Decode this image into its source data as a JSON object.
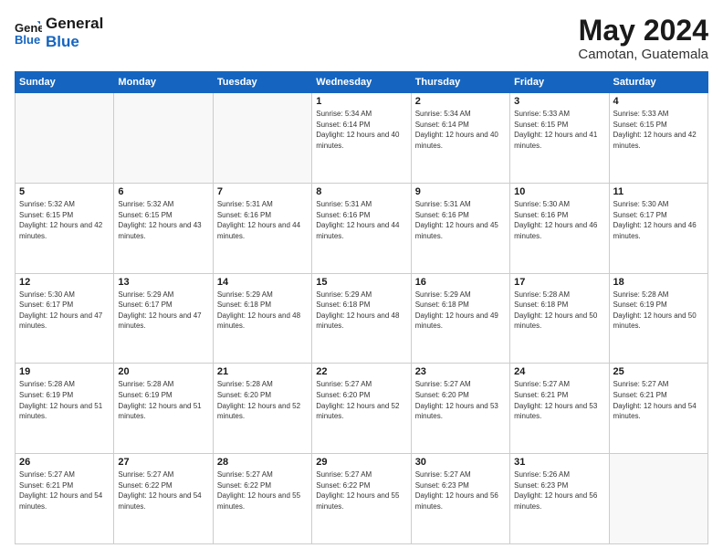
{
  "header": {
    "logo_general": "General",
    "logo_blue": "Blue",
    "main_title": "May 2024",
    "subtitle": "Camotan, Guatemala"
  },
  "days_of_week": [
    "Sunday",
    "Monday",
    "Tuesday",
    "Wednesday",
    "Thursday",
    "Friday",
    "Saturday"
  ],
  "weeks": [
    [
      {
        "day": "",
        "empty": true
      },
      {
        "day": "",
        "empty": true
      },
      {
        "day": "",
        "empty": true
      },
      {
        "day": "1",
        "sunrise": "5:34 AM",
        "sunset": "6:14 PM",
        "daylight": "12 hours and 40 minutes."
      },
      {
        "day": "2",
        "sunrise": "5:34 AM",
        "sunset": "6:14 PM",
        "daylight": "12 hours and 40 minutes."
      },
      {
        "day": "3",
        "sunrise": "5:33 AM",
        "sunset": "6:15 PM",
        "daylight": "12 hours and 41 minutes."
      },
      {
        "day": "4",
        "sunrise": "5:33 AM",
        "sunset": "6:15 PM",
        "daylight": "12 hours and 42 minutes."
      }
    ],
    [
      {
        "day": "5",
        "sunrise": "5:32 AM",
        "sunset": "6:15 PM",
        "daylight": "12 hours and 42 minutes."
      },
      {
        "day": "6",
        "sunrise": "5:32 AM",
        "sunset": "6:15 PM",
        "daylight": "12 hours and 43 minutes."
      },
      {
        "day": "7",
        "sunrise": "5:31 AM",
        "sunset": "6:16 PM",
        "daylight": "12 hours and 44 minutes."
      },
      {
        "day": "8",
        "sunrise": "5:31 AM",
        "sunset": "6:16 PM",
        "daylight": "12 hours and 44 minutes."
      },
      {
        "day": "9",
        "sunrise": "5:31 AM",
        "sunset": "6:16 PM",
        "daylight": "12 hours and 45 minutes."
      },
      {
        "day": "10",
        "sunrise": "5:30 AM",
        "sunset": "6:16 PM",
        "daylight": "12 hours and 46 minutes."
      },
      {
        "day": "11",
        "sunrise": "5:30 AM",
        "sunset": "6:17 PM",
        "daylight": "12 hours and 46 minutes."
      }
    ],
    [
      {
        "day": "12",
        "sunrise": "5:30 AM",
        "sunset": "6:17 PM",
        "daylight": "12 hours and 47 minutes."
      },
      {
        "day": "13",
        "sunrise": "5:29 AM",
        "sunset": "6:17 PM",
        "daylight": "12 hours and 47 minutes."
      },
      {
        "day": "14",
        "sunrise": "5:29 AM",
        "sunset": "6:18 PM",
        "daylight": "12 hours and 48 minutes."
      },
      {
        "day": "15",
        "sunrise": "5:29 AM",
        "sunset": "6:18 PM",
        "daylight": "12 hours and 48 minutes."
      },
      {
        "day": "16",
        "sunrise": "5:29 AM",
        "sunset": "6:18 PM",
        "daylight": "12 hours and 49 minutes."
      },
      {
        "day": "17",
        "sunrise": "5:28 AM",
        "sunset": "6:18 PM",
        "daylight": "12 hours and 50 minutes."
      },
      {
        "day": "18",
        "sunrise": "5:28 AM",
        "sunset": "6:19 PM",
        "daylight": "12 hours and 50 minutes."
      }
    ],
    [
      {
        "day": "19",
        "sunrise": "5:28 AM",
        "sunset": "6:19 PM",
        "daylight": "12 hours and 51 minutes."
      },
      {
        "day": "20",
        "sunrise": "5:28 AM",
        "sunset": "6:19 PM",
        "daylight": "12 hours and 51 minutes."
      },
      {
        "day": "21",
        "sunrise": "5:28 AM",
        "sunset": "6:20 PM",
        "daylight": "12 hours and 52 minutes."
      },
      {
        "day": "22",
        "sunrise": "5:27 AM",
        "sunset": "6:20 PM",
        "daylight": "12 hours and 52 minutes."
      },
      {
        "day": "23",
        "sunrise": "5:27 AM",
        "sunset": "6:20 PM",
        "daylight": "12 hours and 53 minutes."
      },
      {
        "day": "24",
        "sunrise": "5:27 AM",
        "sunset": "6:21 PM",
        "daylight": "12 hours and 53 minutes."
      },
      {
        "day": "25",
        "sunrise": "5:27 AM",
        "sunset": "6:21 PM",
        "daylight": "12 hours and 54 minutes."
      }
    ],
    [
      {
        "day": "26",
        "sunrise": "5:27 AM",
        "sunset": "6:21 PM",
        "daylight": "12 hours and 54 minutes."
      },
      {
        "day": "27",
        "sunrise": "5:27 AM",
        "sunset": "6:22 PM",
        "daylight": "12 hours and 54 minutes."
      },
      {
        "day": "28",
        "sunrise": "5:27 AM",
        "sunset": "6:22 PM",
        "daylight": "12 hours and 55 minutes."
      },
      {
        "day": "29",
        "sunrise": "5:27 AM",
        "sunset": "6:22 PM",
        "daylight": "12 hours and 55 minutes."
      },
      {
        "day": "30",
        "sunrise": "5:27 AM",
        "sunset": "6:23 PM",
        "daylight": "12 hours and 56 minutes."
      },
      {
        "day": "31",
        "sunrise": "5:26 AM",
        "sunset": "6:23 PM",
        "daylight": "12 hours and 56 minutes."
      },
      {
        "day": "",
        "empty": true
      }
    ]
  ]
}
